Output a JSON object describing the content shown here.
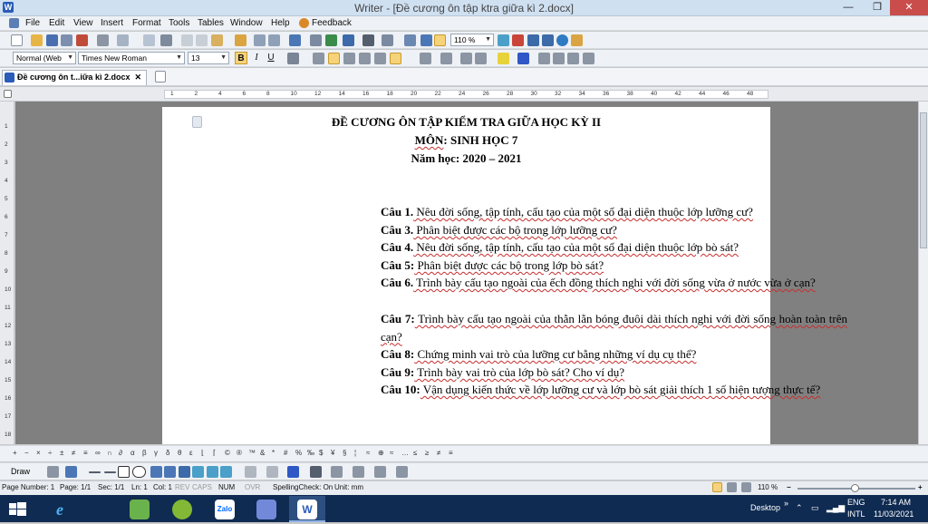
{
  "window": {
    "app_icon": "W",
    "title": "Writer - [Đề cương ôn tập ktra giữa kì 2.docx]",
    "min": "—",
    "max": "❐",
    "close": "✕"
  },
  "menu": [
    "File",
    "Edit",
    "View",
    "Insert",
    "Format",
    "Tools",
    "Tables",
    "Window",
    "Help",
    "Feedback"
  ],
  "toolbar": {
    "zoom": "110 %",
    "style": "Normal (Web",
    "font": "Times New Roman",
    "size": "13",
    "bold": "B",
    "italic": "I",
    "underline": "U"
  },
  "tab": {
    "label": "Đề cương ôn t...iữa kì 2.docx",
    "close": "✕"
  },
  "ruler": [
    "1",
    "2",
    "4",
    "6",
    "8",
    "10",
    "12",
    "14",
    "16",
    "18",
    "20",
    "22",
    "24",
    "26",
    "28",
    "30",
    "32",
    "34",
    "36",
    "38",
    "40",
    "42",
    "44",
    "46",
    "48"
  ],
  "vruler": [
    "1",
    "2",
    "3",
    "4",
    "5",
    "6",
    "7",
    "8",
    "9",
    "10",
    "11",
    "12",
    "13",
    "14",
    "15",
    "16",
    "17",
    "18"
  ],
  "doc": {
    "h1": "ĐỀ CƯƠNG ÔN TẬP KIỂM TRA GIỮA HỌC KỲ II",
    "h2_label": "MÔN",
    "h2_rest": ": SINH HỌC 7",
    "h3": "Năm học: 2020 – 2021",
    "q1_label": "Câu 1.",
    "q1_text": " Nêu đời sống, tập tính, cấu tạo của một số đại diện thuộc lớp lưỡng cư?",
    "q3_label": "Câu 3.",
    "q3_text": " Phân biệt được các bộ trong lớp lưỡng cư?",
    "q4_label": "Câu 4.",
    "q4_text": " Nêu đời sống, tập tính, cấu tạo của một số đại diện thuộc lớp bò sát?",
    "q5_label": "Câu 5:",
    "q5_text": " Phân biệt được các bộ trong lớp bò sát?",
    "q6_label": "Câu 6.",
    "q6_text": " Trình bày cấu tạo ngoài của ếch đồng thích nghi với đời sống vừa ở nước vừa ở cạn?",
    "q7_label": "Câu 7:",
    "q7_text": "  Trình bày cấu tạo ngoài của thằn lằn bóng đuôi dài thích nghi với đời sống hoàn toàn trên cạn?",
    "q8_label": "Câu 8:",
    "q8_text": " Chứng minh vai trò của lưỡng cư bằng những ví dụ cụ thể?",
    "q9_label": "Câu 9:",
    "q9_text": " Trình bày vai trò của lớp bò sát? Cho ví dụ?",
    "q10_label": "Câu 10:",
    "q10_text": " Vận dụng kiến thức về lớp lưỡng cư và lớp bò sát giải thích 1 số hiện tượng thực tế?"
  },
  "symbols": [
    "+",
    "−",
    "×",
    "÷",
    "±",
    "≠",
    "≡",
    "∞",
    "∩",
    "∂",
    "α",
    "β",
    "γ",
    "δ",
    "θ",
    "ε",
    "⌊",
    "⌈",
    "©",
    "®",
    "™",
    "&",
    "*",
    "#",
    "%",
    "‰",
    "$",
    "¥",
    "§",
    "¦",
    "≈",
    "⊕",
    "≈",
    "…",
    "≤",
    "≥",
    "≠",
    "≡"
  ],
  "draw_label": "Draw",
  "status": {
    "page_number": "Page Number: 1",
    "page": "Page: 1/1",
    "sec": "Sec: 1/1",
    "ln": "Ln: 1",
    "col": "Col: 1",
    "rev": "REV",
    "caps": "CAPS",
    "num": "NUM",
    "ovr": "OVR",
    "spell": "SpellingCheck: On",
    "unit": "Unit: mm",
    "zoom": "110 %"
  },
  "taskbar": {
    "desktop": "Desktop",
    "lang1": "ENG",
    "lang2": "INTL",
    "time": "7:14 AM",
    "date": "11/03/2021",
    "zalo": "Zalo"
  },
  "colors": {
    "accent": "#2a5cb8",
    "squiggle": "#c72e2e",
    "taskbar": "#0f2b52"
  }
}
